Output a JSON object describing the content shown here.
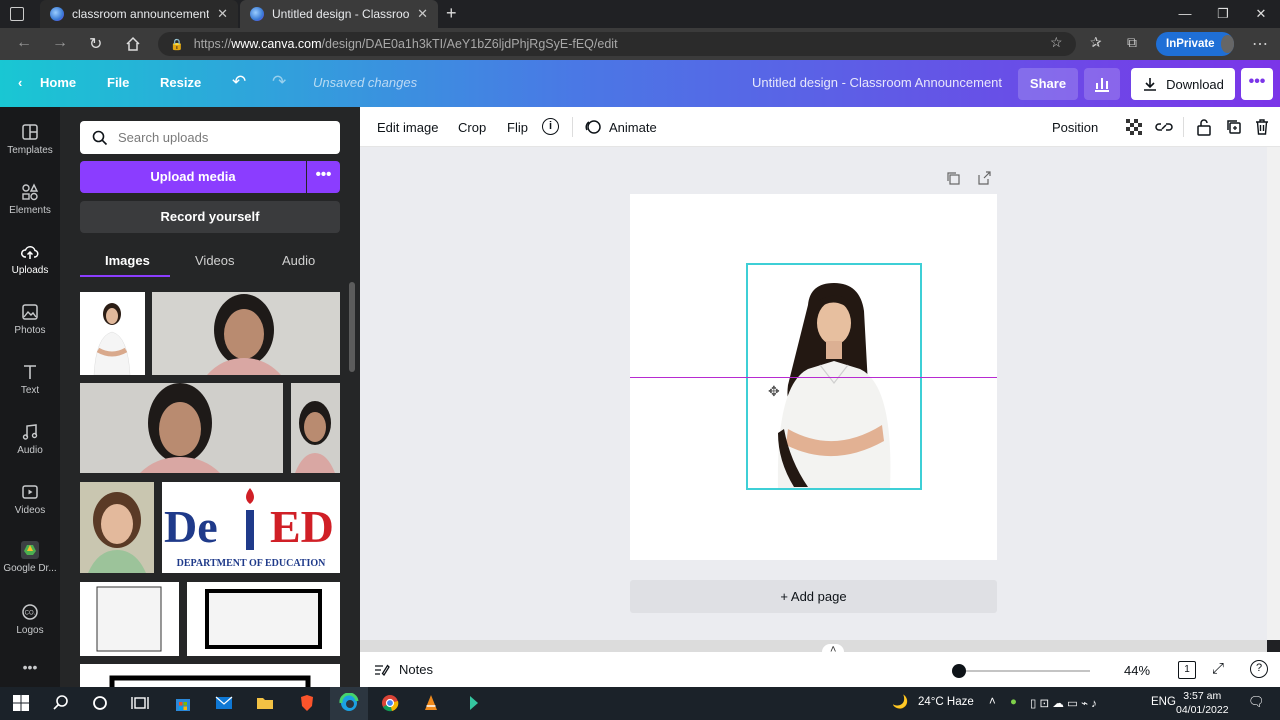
{
  "browser": {
    "tabs": [
      {
        "title": "classroom announcement",
        "active": false
      },
      {
        "title": "Untitled design - Classroom Ann",
        "active": true
      }
    ],
    "url_prefix": "https://",
    "url_domain": "www.canva.com",
    "url_path": "/design/DAE0a1h3kTI/AeY1bZ6ljdPhjRgSyE-fEQ/edit",
    "inprivate_label": "InPrivate",
    "window_controls": [
      "—",
      "❐",
      "✕"
    ]
  },
  "canva_header": {
    "home": "Home",
    "file": "File",
    "resize": "Resize",
    "status": "Unsaved changes",
    "title": "Untitled design - Classroom Announcement",
    "share": "Share",
    "download": "Download",
    "more": "•••"
  },
  "rail": {
    "items": [
      {
        "label": "Templates",
        "icon": "templates-icon"
      },
      {
        "label": "Elements",
        "icon": "elements-icon"
      },
      {
        "label": "Uploads",
        "icon": "upload-cloud-icon",
        "active": true
      },
      {
        "label": "Photos",
        "icon": "photos-icon"
      },
      {
        "label": "Text",
        "icon": "text-icon"
      },
      {
        "label": "Audio",
        "icon": "audio-icon"
      },
      {
        "label": "Videos",
        "icon": "videos-icon"
      },
      {
        "label": "Google Dr...",
        "icon": "google-drive-icon"
      },
      {
        "label": "Logos",
        "icon": "logos-icon"
      }
    ]
  },
  "panel": {
    "search_placeholder": "Search uploads",
    "upload_media": "Upload media",
    "upload_more": "•••",
    "record_yourself": "Record yourself",
    "tabs": [
      "Images",
      "Videos",
      "Audio"
    ],
    "deped_logo": {
      "line1": "DepED",
      "line2": "DEPARTMENT OF EDUCATION"
    }
  },
  "toolbar": {
    "edit_image": "Edit image",
    "crop": "Crop",
    "flip": "Flip",
    "info": "i",
    "animate": "Animate",
    "position": "Position"
  },
  "canvas": {
    "add_page": "+ Add page"
  },
  "bottom": {
    "notes": "Notes",
    "zoom": "44%",
    "page_number": "1",
    "help": "?",
    "zoom_level": 0.02
  },
  "taskbar": {
    "weather": "24°C  Haze",
    "lang": "ENG",
    "time": "3:57 am",
    "date": "04/01/2022"
  },
  "colors": {
    "canva_gradient_start": "#19c7d3",
    "canva_gradient_end": "#7b35e8",
    "upload_button": "#8b3dff",
    "selection": "#3ecfd6",
    "guide_line": "#b72bd1"
  }
}
